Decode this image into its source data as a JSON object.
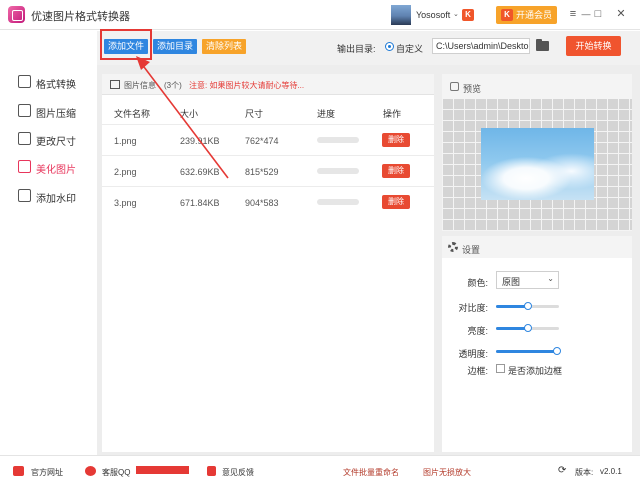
{
  "titlebar": {
    "title": "优速图片格式转换器",
    "username": "Yososoft",
    "user_caret": "⌄",
    "k_badge": "K",
    "vip_label": "开通会员",
    "controls": {
      "menu": "≡",
      "minimize": "—",
      "maximize": "□",
      "close": "✕"
    }
  },
  "sidebar": {
    "items": [
      {
        "label": "格式转换",
        "active": false
      },
      {
        "label": "图片压缩",
        "active": false
      },
      {
        "label": "更改尺寸",
        "active": false
      },
      {
        "label": "美化图片",
        "active": true
      },
      {
        "label": "添加水印",
        "active": false
      }
    ]
  },
  "toolbar": {
    "add_file": "添加文件",
    "add_dir": "添加目录",
    "clear_list": "清除列表",
    "output_label": "输出目录:",
    "radio_label": "自定义",
    "output_path": "C:\\Users\\admin\\Deskto",
    "start_label": "开始转换"
  },
  "file_list": {
    "title": "图片信息",
    "count": "(3个)",
    "warning": "注意: 如果图片较大请耐心等待...",
    "columns": [
      "文件名称",
      "大小",
      "尺寸",
      "进度",
      "操作"
    ],
    "rows": [
      {
        "name": "1.png",
        "size": "239.91KB",
        "dims": "762*474",
        "progress": 0,
        "action": "删除"
      },
      {
        "name": "2.png",
        "size": "632.69KB",
        "dims": "815*529",
        "progress": 0,
        "action": "删除"
      },
      {
        "name": "3.png",
        "size": "671.84KB",
        "dims": "904*583",
        "progress": 0,
        "action": "删除"
      }
    ]
  },
  "preview": {
    "title": "预览"
  },
  "settings": {
    "title": "设置",
    "color_label": "颜色:",
    "color_value": "原图",
    "contrast_label": "对比度:",
    "contrast_value": 0.5,
    "brightness_label": "亮度:",
    "brightness_value": 0.5,
    "opacity_label": "透明度:",
    "opacity_value": 1.0,
    "border_label": "边框:",
    "border_checkbox_label": "是否添加边框",
    "border_checked": false
  },
  "footer": {
    "website": "官方网址",
    "support": "客服QQ",
    "feedback": "意见反馈",
    "batch_rename": "文件批量重命名",
    "lossless_zoom": "图片无损放大",
    "version_label": "版本:",
    "version": "v2.0.1"
  },
  "colors": {
    "accent_red": "#e8365c",
    "blue_btn": "#2f86e0",
    "orange_btn": "#f7a32a",
    "start_btn": "#f0542e",
    "highlight": "#e53935"
  }
}
